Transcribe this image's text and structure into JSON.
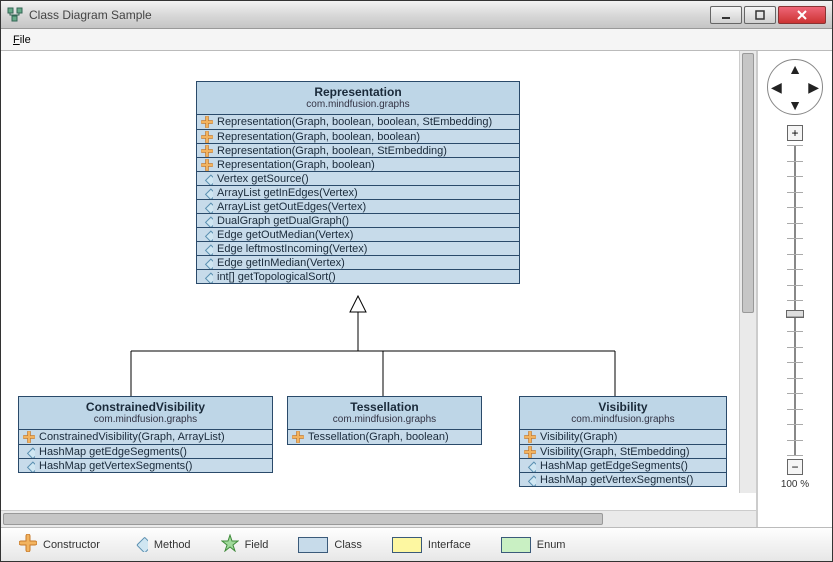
{
  "window": {
    "title": "Class Diagram Sample"
  },
  "menu": {
    "file": "File"
  },
  "zoom": {
    "label": "100 %"
  },
  "legend": {
    "constructor": "Constructor",
    "method": "Method",
    "field": "Field",
    "class": "Class",
    "interface": "Interface",
    "enum": "Enum"
  },
  "colors": {
    "class_fill": "#c7dbea",
    "interface_fill": "#fdf7a1",
    "enum_fill": "#c9f0c3"
  },
  "classes": {
    "representation": {
      "name": "Representation",
      "package": "com.mindfusion.graphs",
      "members": [
        {
          "kind": "ctor",
          "sig": "Representation(Graph, boolean, boolean, StEmbedding)"
        },
        {
          "kind": "ctor",
          "sig": "Representation(Graph, boolean, boolean)"
        },
        {
          "kind": "ctor",
          "sig": "Representation(Graph, boolean, StEmbedding)"
        },
        {
          "kind": "ctor",
          "sig": "Representation(Graph, boolean)"
        },
        {
          "kind": "method",
          "sig": "Vertex getSource()"
        },
        {
          "kind": "method",
          "sig": "ArrayList getInEdges(Vertex)"
        },
        {
          "kind": "method",
          "sig": "ArrayList getOutEdges(Vertex)"
        },
        {
          "kind": "method",
          "sig": "DualGraph getDualGraph()"
        },
        {
          "kind": "method",
          "sig": "Edge getOutMedian(Vertex)"
        },
        {
          "kind": "method",
          "sig": "Edge leftmostIncoming(Vertex)"
        },
        {
          "kind": "method",
          "sig": "Edge getInMedian(Vertex)"
        },
        {
          "kind": "method",
          "sig": "int[] getTopologicalSort()"
        }
      ]
    },
    "constrainedVisibility": {
      "name": "ConstrainedVisibility",
      "package": "com.mindfusion.graphs",
      "members": [
        {
          "kind": "ctor",
          "sig": "ConstrainedVisibility(Graph, ArrayList)"
        },
        {
          "kind": "method",
          "sig": "HashMap getEdgeSegments()"
        },
        {
          "kind": "method",
          "sig": "HashMap getVertexSegments()"
        }
      ]
    },
    "tessellation": {
      "name": "Tessellation",
      "package": "com.mindfusion.graphs",
      "members": [
        {
          "kind": "ctor",
          "sig": "Tessellation(Graph, boolean)"
        }
      ]
    },
    "visibility": {
      "name": "Visibility",
      "package": "com.mindfusion.graphs",
      "members": [
        {
          "kind": "ctor",
          "sig": "Visibility(Graph)"
        },
        {
          "kind": "ctor",
          "sig": "Visibility(Graph, StEmbedding)"
        },
        {
          "kind": "method",
          "sig": "HashMap getEdgeSegments()"
        },
        {
          "kind": "method",
          "sig": "HashMap getVertexSegments()"
        }
      ]
    }
  }
}
